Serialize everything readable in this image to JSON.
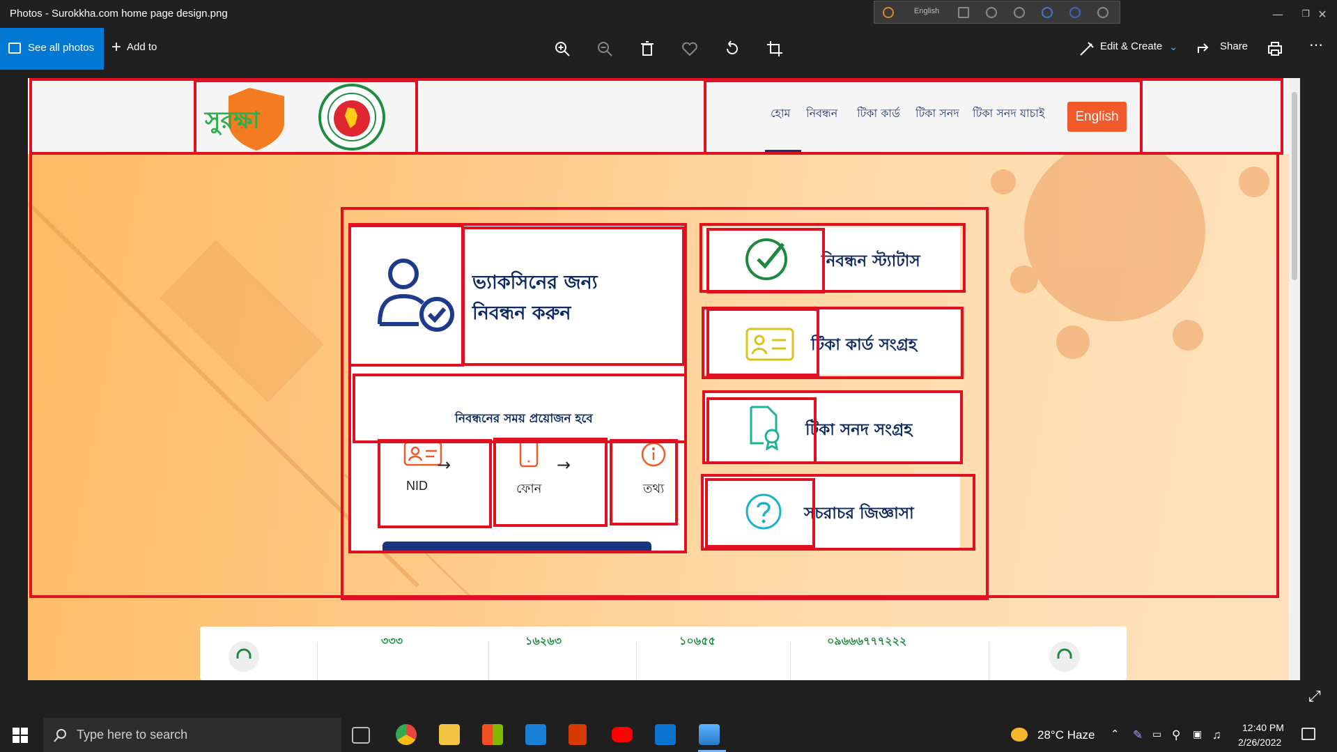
{
  "window": {
    "title": "Photos - Surokkha.com home page design.png",
    "ime_language": "English"
  },
  "toolbar": {
    "see_all_photos": "See all photos",
    "add_to": "Add to",
    "edit_create": "Edit & Create",
    "share": "Share"
  },
  "site": {
    "logo_text": "সুরক্ষা",
    "nav": [
      "হোম",
      "নিবন্ধন",
      "টিকা কার্ড",
      "টিকা সনদ",
      "টিকা সনদ যাচাই"
    ],
    "language_button": "English",
    "register_card": {
      "title_line1": "ভ্যাকসিনের জন্য",
      "title_line2": "নিবন্ধন করুন",
      "requirements_label": "নিবন্ধনের সময় প্রয়োজন হবে",
      "steps": [
        "NID",
        "ফোন",
        "তথ্য"
      ]
    },
    "side_cards": [
      "নিবন্ধন স্ট্যাটাস",
      "টিকা কার্ড সংগ্রহ",
      "টিকা সনদ সংগ্রহ",
      "সচরাচর জিজ্ঞাসা"
    ],
    "stats": [
      "৩৩৩",
      "১৬২৬৩",
      "১০৬৫৫",
      "০৯৬৬৬৭৭৭২২২"
    ]
  },
  "taskbar": {
    "search_placeholder": "Type here to search",
    "weather": "28°C  Haze",
    "time": "12:40 PM",
    "date": "2/26/2022"
  },
  "colors": {
    "accent": "#0078d4",
    "annotation_red": "#e01020",
    "brand_orange": "#f05a2a",
    "navy": "#1f2f73"
  }
}
